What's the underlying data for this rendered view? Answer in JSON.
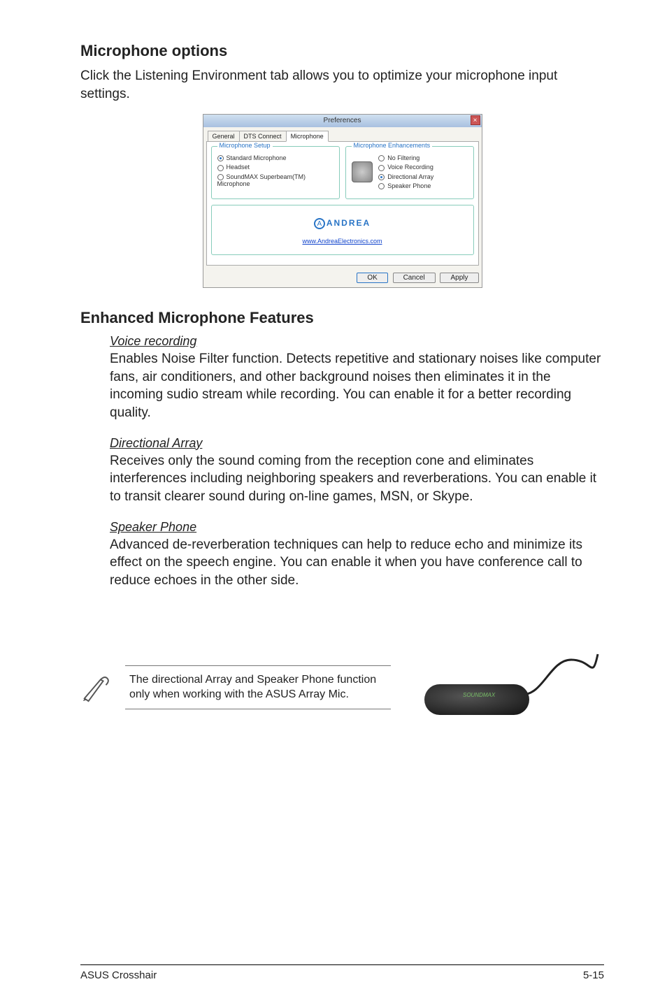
{
  "section1": {
    "heading": "Microphone options",
    "body": "Click the Listening Environment tab allows you to optimize your microphone input settings."
  },
  "dialog": {
    "title": "Preferences",
    "tabs": {
      "general": "General",
      "dts": "DTS Connect",
      "mic": "Microphone"
    },
    "group_setup_legend": "Microphone Setup",
    "setup_opts": {
      "standard": "Standard Microphone",
      "headset": "Headset",
      "superbeam": "SoundMAX Superbeam(TM) Microphone"
    },
    "group_enh_legend": "Microphone Enhancements",
    "enh_opts": {
      "nofilter": "No Filtering",
      "voice": "Voice Recording",
      "dir": "Directional Array",
      "speaker": "Speaker Phone"
    },
    "andrea_brand": "ANDREA",
    "andrea_link": "www.AndreaElectronics.com",
    "buttons": {
      "ok": "OK",
      "cancel": "Cancel",
      "apply": "Apply"
    }
  },
  "section2": {
    "heading": "Enhanced Microphone Features",
    "voice": {
      "title": "Voice recording",
      "body": "Enables Noise Filter function. Detects repetitive and stationary noises like computer fans, air conditioners, and other background noises then eliminates it in the incoming sudio stream while recording. You can enable it for a better recording quality."
    },
    "dir": {
      "title": "Directional Array",
      "body": "Receives only the sound coming from the reception cone and eliminates interferences including neighboring speakers and reverberations. You can enable it to transit clearer sound during on-line games, MSN, or Skype."
    },
    "spk": {
      "title": "Speaker Phone",
      "body": "Advanced de-reverberation techniques can help to reduce echo and minimize its effect on the speech engine. You can enable it when you have conference call to reduce echoes in the other side."
    }
  },
  "note": {
    "text": "The directional Array and Speaker Phone function only when working with the ASUS Array Mic.",
    "badge": "SOUNDMAX"
  },
  "footer": {
    "left": "ASUS Crosshair",
    "right": "5-15"
  }
}
